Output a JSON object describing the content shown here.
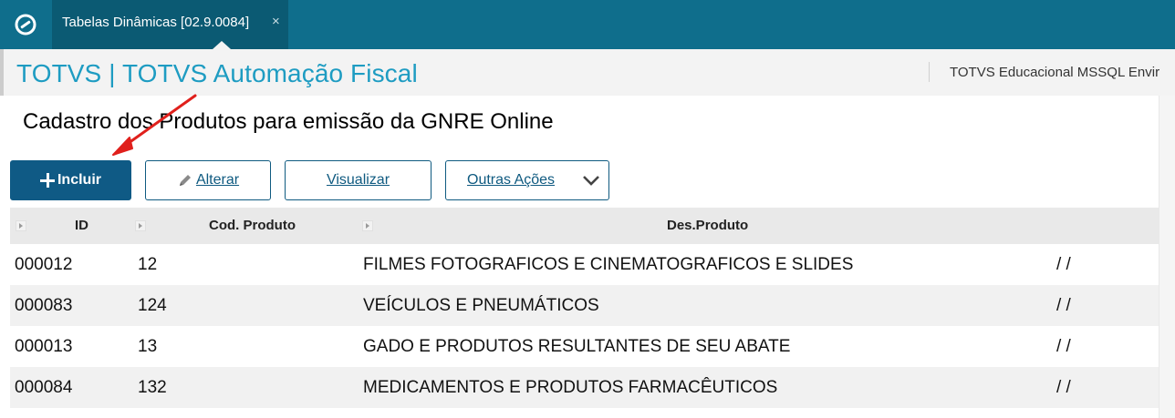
{
  "tabs": [
    {
      "label": "Tabelas Dinâmicas [02.9.0084]",
      "close": "×"
    }
  ],
  "header": {
    "app_title": "TOTVS | TOTVS Automação Fiscal",
    "environment": "TOTVS Educacional MSSQL Envir"
  },
  "page": {
    "title": "Cadastro dos Produtos para emissão da GNRE Online"
  },
  "toolbar": {
    "incluir_label": "Incluir",
    "alterar_label": "Alterar",
    "visualizar_label": "Visualizar",
    "outras_label": "Outras Ações"
  },
  "grid": {
    "columns": [
      "ID",
      "Cod. Produto",
      "Des.Produto"
    ],
    "rows": [
      {
        "id": "000012",
        "cod": "12",
        "des": "FILMES FOTOGRAFICOS E CINEMATOGRAFICOS E SLIDES",
        "date": "/  /"
      },
      {
        "id": "000083",
        "cod": "124",
        "des": "VEÍCULOS E PNEUMÁTICOS",
        "date": "/  /"
      },
      {
        "id": "000013",
        "cod": "13",
        "des": "GADO E PRODUTOS RESULTANTES DE SEU ABATE",
        "date": "/  /"
      },
      {
        "id": "000084",
        "cod": "132",
        "des": "MEDICAMENTOS E PRODUTOS FARMACÊUTICOS",
        "date": "/  /"
      }
    ]
  },
  "icons": {
    "logo": "totvs-logo-icon",
    "incluir": "plus-icon",
    "alterar": "pencil-icon",
    "outras": "chevron-down-icon",
    "sort": "sort-arrow-icon"
  },
  "colors": {
    "topbar": "#0f6e8c",
    "active_tab": "#0b5a73",
    "title": "#1e9cc2",
    "primary_button": "#0f5a85",
    "annotation_arrow": "#e0201c"
  }
}
